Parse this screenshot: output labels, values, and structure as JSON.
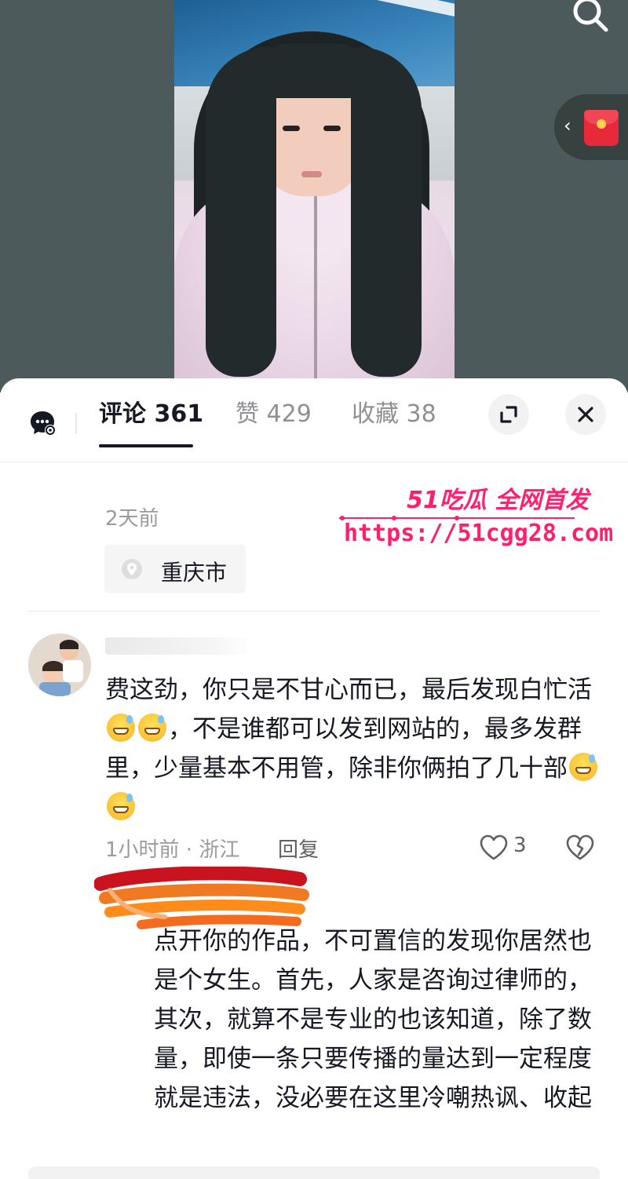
{
  "tabs": {
    "comments_label": "评论 361",
    "likes_label": "赞 429",
    "favorites_label": "收藏 38"
  },
  "post": {
    "time_ago": "2天前",
    "location": "重庆市"
  },
  "watermark": {
    "title": "51吃瓜 全网首发",
    "url": "https://51cgg28.com"
  },
  "comment": {
    "text_1": "费这劲，你只是不甘心而已，最后发现白忙活",
    "text_2": "，不是谁都可以发到网站的，最多发群里，少量基本不用管，除非你俩拍了几十部",
    "meta": "1小时前 · 浙江",
    "reply_label": "回复",
    "like_count": "3"
  },
  "reply": {
    "text": "点开你的作品，不可置信的发现你居然也是个女生。首先，人家是咨询过律师的，其次，就算不是专业的也该知道，除了数量，即使一条只要传播的量达到一定程度就是违法，没必要在这里冷嘲热讽、",
    "collapse_label": "收起"
  },
  "colors": {
    "video_bg": "#4c5a5c",
    "watermark": "#ff1f6e",
    "redpacket": "#e8293a",
    "text_primary": "#161823",
    "text_secondary": "#9a9ba0"
  },
  "icons": [
    "search-icon",
    "chevron-left-icon",
    "red-packet-icon",
    "chat-settings-icon",
    "expand-icon",
    "close-icon",
    "location-pin-icon",
    "heart-icon",
    "broken-heart-icon",
    "emoji-grin-sweat-icon"
  ]
}
